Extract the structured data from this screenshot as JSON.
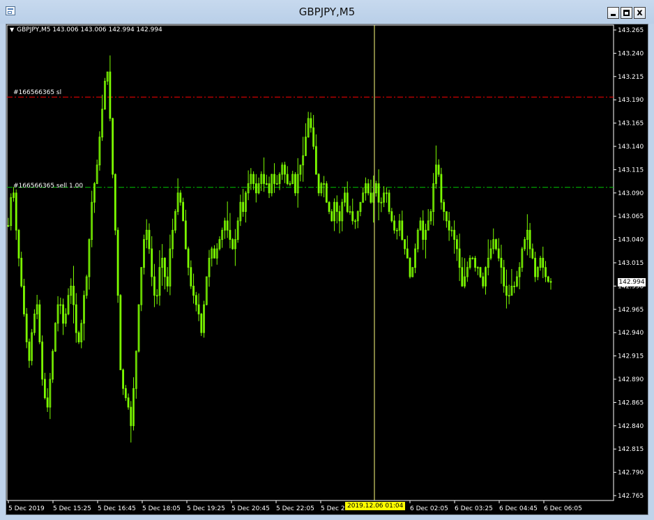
{
  "window": {
    "title": "GBPJPY,M5",
    "buttons": {
      "minimize": "minimize",
      "maximize": "maximize",
      "close": "x"
    }
  },
  "chart": {
    "symbol_info": "GBPJPY,M5  143.006 143.006 142.994 142.994",
    "bid_price_label": "142.994",
    "bid_price": 142.994,
    "cursor_time_label": "2019.12.06 01:04",
    "colors": {
      "background": "#000000",
      "candles": "#7cfc00",
      "axis": "#ffffff",
      "sl_line": "#ff0000",
      "order_line": "#00c800",
      "crosshair": "#ffff80",
      "cursor_time_bg": "#ffff00"
    },
    "horizontal_lines": [
      {
        "label": "#166566365 sl",
        "price": 143.193,
        "color": "#ff0000",
        "style": "dash-dot"
      },
      {
        "label": "#166566365 sell 1.00",
        "price": 143.096,
        "color": "#00c800",
        "style": "dash-dot"
      }
    ]
  },
  "chart_data": {
    "type": "candlestick",
    "symbol": "GBPJPY",
    "timeframe": "M5",
    "y_range": [
      142.759,
      143.27
    ],
    "y_ticks": [
      "143.265",
      "143.240",
      "143.215",
      "143.190",
      "143.165",
      "143.140",
      "143.115",
      "143.090",
      "143.065",
      "143.040",
      "143.015",
      "142.990",
      "142.965",
      "142.940",
      "142.915",
      "142.890",
      "142.865",
      "142.840",
      "142.815",
      "142.790",
      "142.765"
    ],
    "y_tick_values": [
      143.265,
      143.24,
      143.215,
      143.19,
      143.165,
      143.14,
      143.115,
      143.09,
      143.065,
      143.04,
      143.015,
      142.99,
      142.965,
      142.94,
      142.915,
      142.89,
      142.865,
      142.84,
      142.815,
      142.79,
      142.765
    ],
    "x_ticks": [
      "5 Dec 2019",
      "5 Dec 15:25",
      "5 Dec 16:45",
      "5 Dec 18:05",
      "5 Dec 19:25",
      "5 Dec 20:45",
      "5 Dec 22:05",
      "5 Dec 23",
      "6 Dec 02:05",
      "6 Dec 03:25",
      "6 Dec 04:45",
      "6 Dec 06:05"
    ],
    "close_series": [
      143.055,
      143.085,
      143.09,
      143.05,
      143.02,
      142.99,
      142.96,
      142.93,
      142.91,
      142.94,
      142.96,
      142.97,
      142.93,
      142.89,
      142.87,
      142.86,
      142.89,
      142.92,
      142.95,
      142.97,
      142.97,
      142.95,
      142.96,
      142.98,
      142.99,
      142.97,
      142.94,
      142.93,
      142.95,
      142.98,
      143.0,
      143.04,
      143.08,
      143.1,
      143.12,
      143.15,
      143.18,
      143.21,
      143.22,
      143.17,
      143.11,
      143.05,
      142.98,
      142.9,
      142.88,
      142.87,
      142.86,
      142.84,
      142.88,
      142.92,
      142.97,
      143.01,
      143.04,
      143.05,
      143.03,
      143.0,
      142.98,
      142.98,
      143.01,
      143.02,
      143.0,
      142.99,
      143.03,
      143.05,
      143.07,
      143.09,
      143.08,
      143.06,
      143.03,
      143.01,
      142.99,
      142.98,
      142.97,
      142.96,
      142.94,
      142.97,
      143.0,
      143.02,
      143.03,
      143.02,
      143.03,
      143.04,
      143.05,
      143.06,
      143.05,
      143.04,
      143.03,
      143.04,
      143.06,
      143.08,
      143.07,
      143.09,
      143.1,
      143.11,
      143.1,
      143.09,
      143.1,
      143.11,
      143.1,
      143.1,
      143.09,
      143.11,
      143.1,
      143.1,
      143.11,
      143.12,
      143.11,
      143.1,
      143.1,
      143.11,
      143.09,
      143.11,
      143.12,
      143.13,
      143.15,
      143.17,
      143.16,
      143.14,
      143.11,
      143.09,
      143.1,
      143.1,
      143.08,
      143.07,
      143.06,
      143.08,
      143.07,
      143.06,
      143.08,
      143.09,
      143.07,
      143.07,
      143.06,
      143.06,
      143.07,
      143.08,
      143.09,
      143.1,
      143.09,
      143.08,
      143.09,
      143.1,
      143.08,
      143.08,
      143.09,
      143.09,
      143.07,
      143.06,
      143.05,
      143.05,
      143.06,
      143.04,
      143.03,
      143.02,
      143.0,
      143.01,
      143.03,
      143.05,
      143.06,
      143.04,
      143.05,
      143.06,
      143.07,
      143.1,
      143.12,
      143.11,
      143.08,
      143.07,
      143.06,
      143.05,
      143.05,
      143.04,
      143.03,
      143.01,
      142.99,
      143.0,
      143.01,
      143.02,
      143.02,
      143.01,
      143.01,
      143.0,
      142.99,
      143.01,
      143.02,
      143.03,
      143.04,
      143.03,
      143.02,
      143.01,
      142.99,
      142.98,
      142.98,
      142.99,
      142.99,
      143.0,
      143.01,
      143.03,
      143.04,
      143.05,
      143.03,
      143.02,
      143.0,
      143.01,
      143.02,
      143.01,
      143.0,
      142.995,
      142.994
    ]
  }
}
